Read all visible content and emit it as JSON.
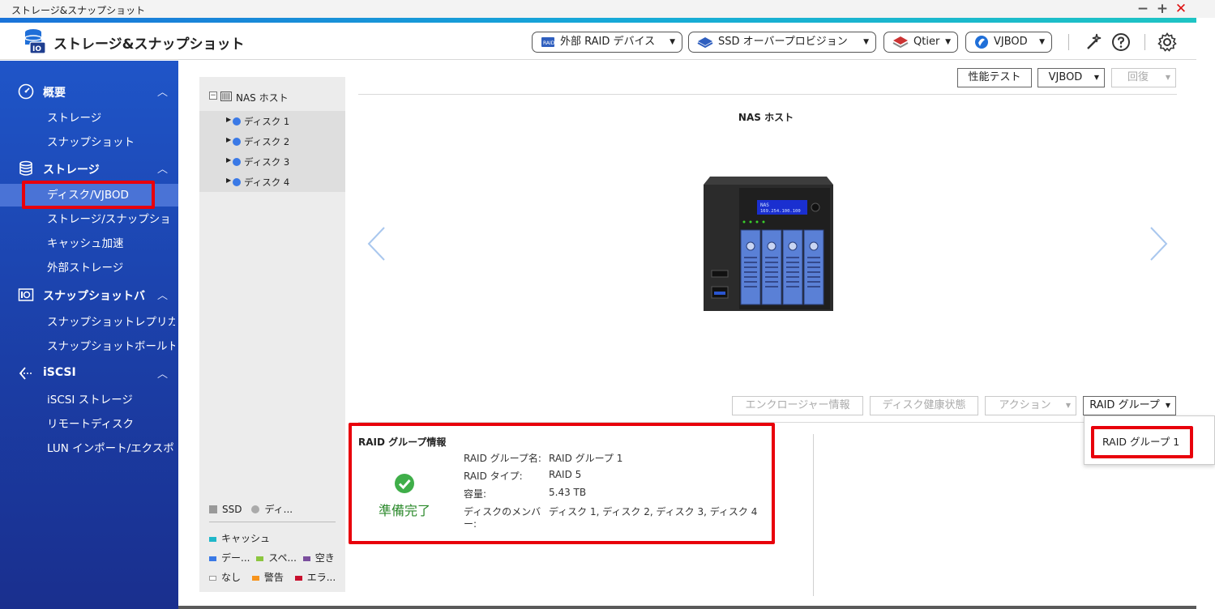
{
  "window": {
    "title": "ストレージ&スナップショット",
    "minimize": "−",
    "maximize": "+",
    "close": "✕"
  },
  "header": {
    "app_title": "ストレージ&スナップショット",
    "buttons": {
      "external_raid": "外部 RAID デバイス",
      "ssd_overprov": "SSD オーバープロビジョン",
      "qtier": "Qtier",
      "vjbod": "VJBOD"
    },
    "icons": [
      "wand-icon",
      "help-icon",
      "settings-icon"
    ]
  },
  "sidebar": {
    "sections": [
      {
        "label": "概要",
        "icon": "dashboard-icon",
        "items": [
          "ストレージ",
          "スナップショット"
        ]
      },
      {
        "label": "ストレージ",
        "icon": "database-icon",
        "items": [
          "ディスク/VJBOD",
          "ストレージ/スナップショ",
          "キャッシュ加速",
          "外部ストレージ"
        ]
      },
      {
        "label": "スナップショットバ",
        "icon": "snapshot-icon",
        "items": [
          "スナップショットレプリカ",
          "スナップショットボールト"
        ]
      },
      {
        "label": "iSCSI",
        "icon": "iscsi-icon",
        "items": [
          "iSCSI ストレージ",
          "リモートディスク",
          "LUN インポート/エクスポ"
        ]
      }
    ],
    "active_item": "ディスク/VJBOD",
    "chevron": "︿"
  },
  "tree": {
    "root_label": "NAS ホスト",
    "expand_glyph": "⊟",
    "disks": [
      "ディスク 1",
      "ディスク 2",
      "ディスク 3",
      "ディスク 4"
    ],
    "legend": {
      "ssd": "SSD",
      "disk": "ディ...",
      "cache": "キャッシュ",
      "data": "デー...",
      "spare": "スペ...",
      "free": "空き",
      "none": "なし",
      "warning": "警告",
      "error": "エラ..."
    },
    "legend_colors": {
      "cache": "#1fb7c9",
      "data": "#3a79e6",
      "spare": "#8cc63f",
      "free": "#7b4f9e",
      "none": "#ffffff",
      "warning": "#f7941d",
      "error": "#c8102e"
    }
  },
  "toolbar": {
    "perf_test": "性能テスト",
    "vjbod": "VJBOD",
    "recover": "回復"
  },
  "main": {
    "nas_label": "NAS ホスト",
    "lcd_line1": "NAS",
    "lcd_line2": "169.254.100.100",
    "actions": {
      "enclosure": "エンクロージャー情報",
      "disk_health": "ディスク健康状態",
      "action": "アクション",
      "raid_group": "RAID グループ"
    }
  },
  "raid_info": {
    "title": "RAID グループ情報",
    "status": "準備完了",
    "fields": [
      {
        "key": "RAID グループ名:",
        "value": "RAID グループ 1"
      },
      {
        "key": "RAID タイプ:",
        "value": "RAID 5"
      },
      {
        "key": "容量:",
        "value": "5.43 TB"
      },
      {
        "key": "ディスクのメンバ",
        "value": "ディスク 1, ディスク 2, ディスク 3, ディスク 4"
      }
    ],
    "key_continuation": "ー:"
  },
  "dropdown": {
    "items": [
      "RAID グループ 1"
    ]
  },
  "colors": {
    "accent_blue": "#1f55c8",
    "highlight_red": "#e8000b",
    "ready_green": "#2c8a2c"
  }
}
